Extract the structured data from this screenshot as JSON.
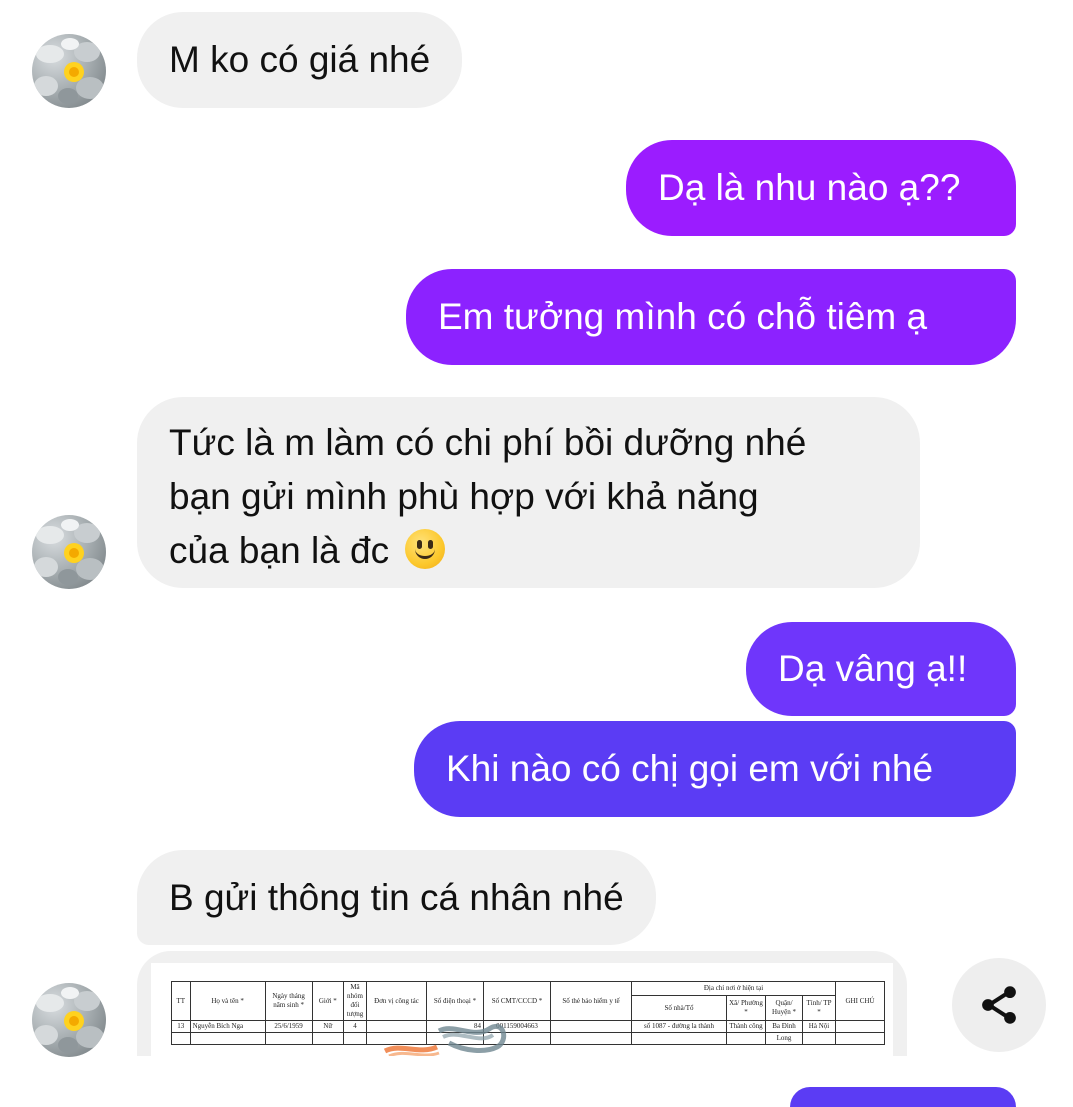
{
  "messages": [
    {
      "side": "in",
      "text": "M ko có giá nhé"
    },
    {
      "side": "out",
      "text": "Dạ là nhu nào ạ??"
    },
    {
      "side": "out",
      "text": "Em tưởng mình có chỗ tiêm ạ"
    },
    {
      "side": "in",
      "lines": [
        "Tức là m làm có chi phí bồi dưỡng nhé",
        "bạn gửi mình phù hợp với khả năng",
        "của bạn là đc"
      ],
      "emoji": "slightly-smiling-face-icon"
    },
    {
      "side": "out",
      "text": "Dạ vâng ạ!!"
    },
    {
      "side": "out",
      "text": "Khi nào có chị gọi em với nhé"
    },
    {
      "side": "in",
      "text": "B gửi thông tin cá nhân nhé"
    }
  ],
  "attachment": {
    "table": {
      "headers": {
        "tt": "TT",
        "name": "Họ và tên *",
        "dob": "Ngày tháng năm sinh *",
        "gender": "Giới *",
        "group": "Mã nhóm đối tượng",
        "workplace": "Đơn vị công tác",
        "phone": "Số điện thoại *",
        "id_number": "Số CMT/CCCD *",
        "insurance": "Số thẻ bảo hiểm y tế",
        "address_group": "Địa chỉ nơi ở hiện tại",
        "street": "Số nhà/Tổ",
        "ward": "Xã/ Phường *",
        "district": "Quận/ Huyện *",
        "province": "Tỉnh/ TP *",
        "note": "GHI CHÚ"
      },
      "row": {
        "tt": "13",
        "name": "Nguyễn Bích Nga",
        "dob": "25/6/1959",
        "gender": "Nữ",
        "group": "4",
        "phone_suffix": "84",
        "id_number": "001159004663",
        "street": "số 1087 - đường la thành",
        "ward": "Thành công",
        "district": "Ba Đình",
        "province": "Hà Nội"
      },
      "next_row_partial": "Long"
    }
  },
  "actions": {
    "share_icon": "share-icon"
  },
  "colors": {
    "incoming_bubble": "#f0f0f0",
    "outgoing_top": "#9b1cff",
    "outgoing_mid": "#7f30ff",
    "outgoing_bottom": "#5b3cf4"
  }
}
